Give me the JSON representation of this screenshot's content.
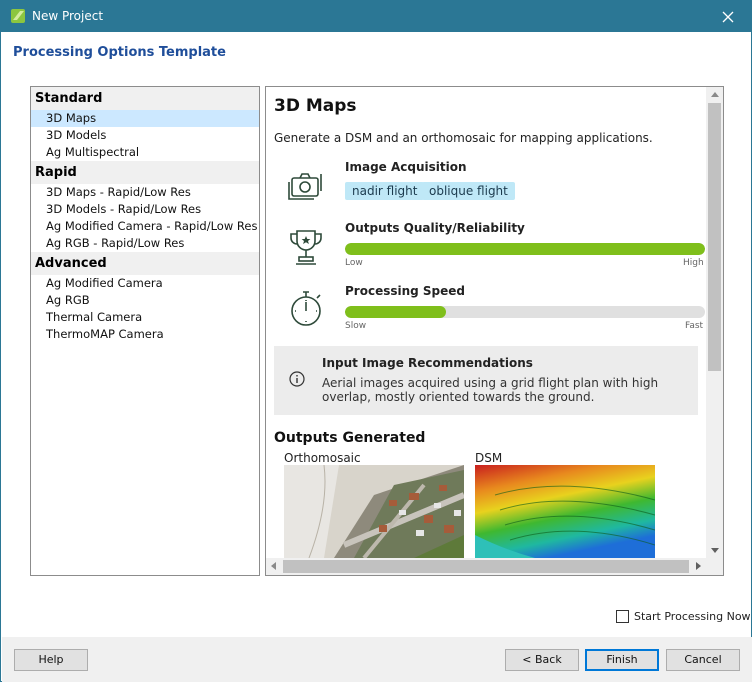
{
  "window": {
    "title": "New Project"
  },
  "page": {
    "heading": "Processing Options Template"
  },
  "templates": {
    "groups": [
      {
        "label": "Standard",
        "items": [
          "3D Maps",
          "3D Models",
          "Ag Multispectral"
        ]
      },
      {
        "label": "Rapid",
        "items": [
          "3D Maps - Rapid/Low Res",
          "3D Models - Rapid/Low Res",
          "Ag Modified Camera - Rapid/Low Res",
          "Ag RGB - Rapid/Low Res"
        ]
      },
      {
        "label": "Advanced",
        "items": [
          "Ag Modified Camera",
          "Ag RGB",
          "Thermal Camera",
          "ThermoMAP Camera"
        ]
      }
    ],
    "selected": "3D Maps"
  },
  "detail": {
    "title": "3D Maps",
    "description": "Generate a DSM and an orthomosaic for mapping applications.",
    "image_acquisition": {
      "title": "Image Acquisition",
      "tags": [
        "nadir flight",
        "oblique flight"
      ]
    },
    "quality": {
      "title": "Outputs Quality/Reliability",
      "min_label": "Low",
      "max_label": "High",
      "level": 1.0
    },
    "speed": {
      "title": "Processing Speed",
      "min_label": "Slow",
      "max_label": "Fast",
      "level": 0.28
    },
    "recommendation": {
      "title": "Input Image Recommendations",
      "text": "Aerial images acquired using a grid flight plan with high overlap, mostly oriented towards the ground."
    },
    "outputs": {
      "title": "Outputs Generated",
      "items": [
        "Orthomosaic",
        "DSM"
      ]
    }
  },
  "options": {
    "start_processing_label": "Start Processing Now",
    "start_processing_checked": false
  },
  "buttons": {
    "help": "Help",
    "back": "< Back",
    "finish": "Finish",
    "cancel": "Cancel"
  },
  "colors": {
    "titlebar": "#2b7795",
    "heading": "#1f4e9a",
    "progress_fill": "#7fbf1b",
    "tag_bg": "#bfe8f7",
    "selection": "#cce8ff"
  }
}
